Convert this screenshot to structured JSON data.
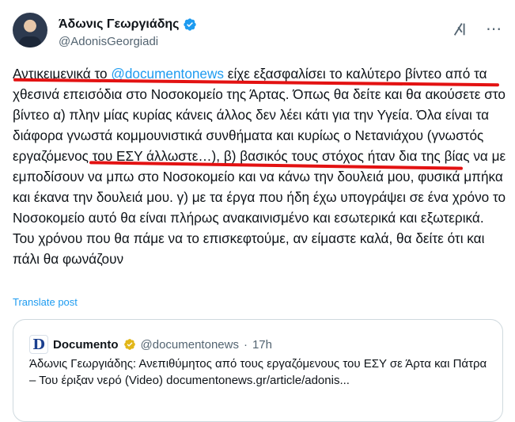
{
  "author": {
    "display_name": "Άδωνις Γεωργιάδης",
    "handle": "@AdonisGeorgiadi",
    "verified_icon": "verified-badge-icon"
  },
  "post": {
    "t1": "Αντικειμενικά το ",
    "mention": "@documentonews",
    "t2": " είχε εξασφαλίσει το καλύτερο βίντεο από τα χθεσινά επεισόδια στο Νοσοκομείο της Άρτας. Όπως θα δείτε και θα ακούσετε στο βίντεο α) πλην μίας κυρίας κάνεις άλλος δεν λέει κάτι για την Υγεία. Όλα είναι τα διάφορα γνωστά κομμουνιστικά συνθήματα και κυρίως ο Νετανιάχου (γνωστός εργαζόμενος του ΕΣΥ άλλωστε…), β) βασικός τους στόχος ήταν δια της βίας να με εμποδίσουν να μπω στο Νοσοκομείο και να κάνω την δουλειά μου, φυσικά μπήκα και έκανα την δουλειά μου. γ) με τα έργα που ήδη έχω υπογράψει σε ένα χρόνο το Νοσοκομείο αυτό θα είναι πλήρως ανακαινισμένο και εσωτερικά και εξωτερικά. Του χρόνου που θα πάμε να το επισκεφτούμε, αν είμαστε καλά, θα δείτε ότι και πάλι θα φωνάζουν"
  },
  "translate_label": "Translate post",
  "quote": {
    "logo_letter": "D",
    "name": "Documento",
    "handle": "@documentonews",
    "separator": "·",
    "time": "17h",
    "text": "Άδωνις Γεωργιάδης: Ανεπιθύμητος από τους εργαζόμενους του ΕΣΥ σε Άρτα και Πάτρα – Του έριξαν νερό (Video) documentonews.gr/article/adonis..."
  },
  "icons": {
    "grok": "grok-icon",
    "more": "more-options-icon",
    "verified_gold": "verified-org-badge-icon"
  },
  "colors": {
    "accent": "#1d9bf0",
    "highlight": "#e31212",
    "gold_badge": "#e2b719",
    "text": "#0f1419",
    "muted": "#536471"
  }
}
